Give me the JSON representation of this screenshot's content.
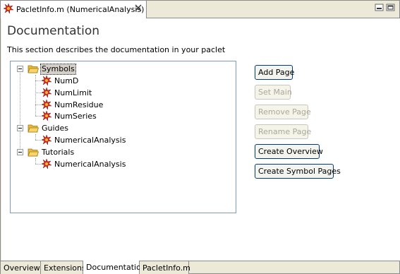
{
  "window": {
    "tab_title": "PacletInfo.m (NumericalAnalysis)",
    "tab_icon": "paclet-icon",
    "close_icon": "close-icon"
  },
  "page": {
    "title": "Documentation",
    "description": "This section describes the documentation in your paclet"
  },
  "tree": {
    "groups": [
      {
        "label": "Symbols",
        "selected": true,
        "children": [
          "NumD",
          "NumLimit",
          "NumResidue",
          "NumSeries"
        ]
      },
      {
        "label": "Guides",
        "selected": false,
        "children": [
          "NumericalAnalysis"
        ]
      },
      {
        "label": "Tutorials",
        "selected": false,
        "children": [
          "NumericalAnalysis"
        ]
      }
    ]
  },
  "buttons": {
    "add_page": "Add Page",
    "set_main": "Set Main",
    "remove_page": "Remove Page",
    "rename_page": "Rename Page",
    "create_overview": "Create Overview",
    "create_symbol_pages": "Create Symbol Pages"
  },
  "bottom_tabs": [
    "Overview",
    "Extensions",
    "Documentation",
    "PacletInfo.m"
  ],
  "active_bottom_tab": "Documentation",
  "colors": {
    "accent_border": "#003c74",
    "tree_border": "#7f9db9",
    "folder": "#f2c94c",
    "paclet_red": "#d22a1f"
  }
}
